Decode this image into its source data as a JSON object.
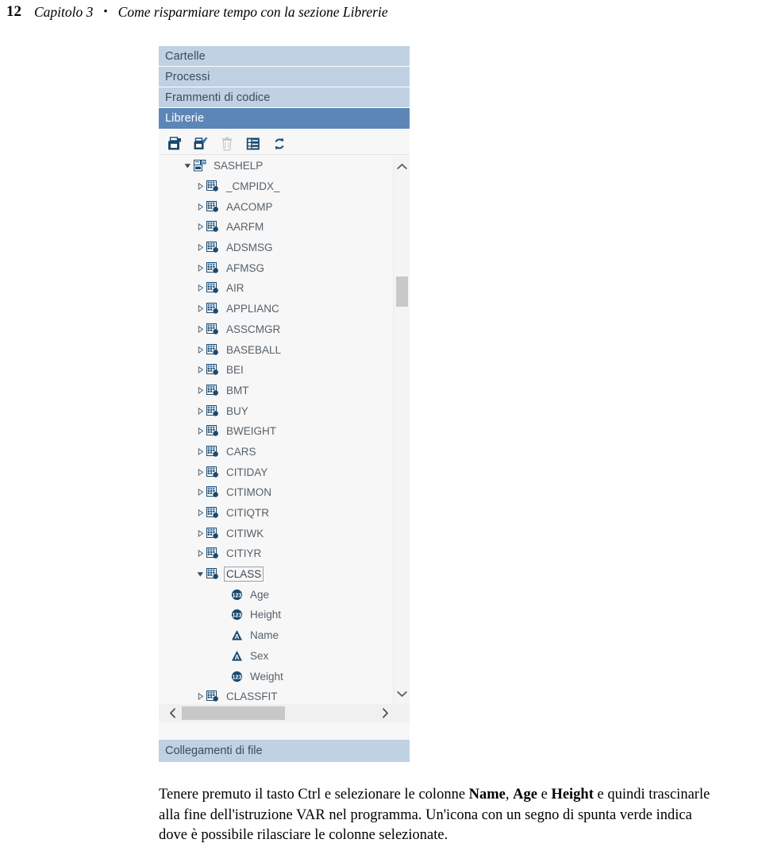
{
  "running_head": {
    "page_number": "12",
    "chapter": "Capitolo 3",
    "separator": "•",
    "title": "Come risparmiare tempo con la sezione Librerie"
  },
  "panel": {
    "tabs": [
      {
        "label": "Cartelle",
        "active": false
      },
      {
        "label": "Processi",
        "active": false
      },
      {
        "label": "Frammenti di codice",
        "active": false
      },
      {
        "label": "Librerie",
        "active": true
      }
    ],
    "toolbar": [
      {
        "name": "new-library-icon",
        "title": "Nuova libreria",
        "enabled": true
      },
      {
        "name": "edit-library-icon",
        "title": "Modifica libreria",
        "enabled": true
      },
      {
        "name": "delete-icon",
        "title": "Elimina",
        "enabled": false
      },
      {
        "name": "properties-icon",
        "title": "Proprieta",
        "enabled": true
      },
      {
        "name": "refresh-icon",
        "title": "Aggiorna",
        "enabled": true
      }
    ],
    "tree": [
      {
        "label": "SASHELP",
        "level": 0,
        "icon": "library-icon",
        "state": "expanded",
        "selected": false
      },
      {
        "label": "_CMPIDX_",
        "level": 1,
        "icon": "dataset-icon",
        "state": "collapsed",
        "selected": false
      },
      {
        "label": "AACOMP",
        "level": 1,
        "icon": "dataset-icon",
        "state": "collapsed",
        "selected": false
      },
      {
        "label": "AARFM",
        "level": 1,
        "icon": "dataset-icon",
        "state": "collapsed",
        "selected": false
      },
      {
        "label": "ADSMSG",
        "level": 1,
        "icon": "dataset-icon",
        "state": "collapsed",
        "selected": false
      },
      {
        "label": "AFMSG",
        "level": 1,
        "icon": "dataset-icon",
        "state": "collapsed",
        "selected": false
      },
      {
        "label": "AIR",
        "level": 1,
        "icon": "dataset-icon",
        "state": "collapsed",
        "selected": false
      },
      {
        "label": "APPLIANC",
        "level": 1,
        "icon": "dataset-icon",
        "state": "collapsed",
        "selected": false
      },
      {
        "label": "ASSCMGR",
        "level": 1,
        "icon": "dataset-icon",
        "state": "collapsed",
        "selected": false
      },
      {
        "label": "BASEBALL",
        "level": 1,
        "icon": "dataset-icon",
        "state": "collapsed",
        "selected": false
      },
      {
        "label": "BEI",
        "level": 1,
        "icon": "dataset-icon",
        "state": "collapsed",
        "selected": false
      },
      {
        "label": "BMT",
        "level": 1,
        "icon": "dataset-icon",
        "state": "collapsed",
        "selected": false
      },
      {
        "label": "BUY",
        "level": 1,
        "icon": "dataset-icon",
        "state": "collapsed",
        "selected": false
      },
      {
        "label": "BWEIGHT",
        "level": 1,
        "icon": "dataset-icon",
        "state": "collapsed",
        "selected": false
      },
      {
        "label": "CARS",
        "level": 1,
        "icon": "dataset-icon",
        "state": "collapsed",
        "selected": false
      },
      {
        "label": "CITIDAY",
        "level": 1,
        "icon": "dataset-icon",
        "state": "collapsed",
        "selected": false
      },
      {
        "label": "CITIMON",
        "level": 1,
        "icon": "dataset-icon",
        "state": "collapsed",
        "selected": false
      },
      {
        "label": "CITIQTR",
        "level": 1,
        "icon": "dataset-icon",
        "state": "collapsed",
        "selected": false
      },
      {
        "label": "CITIWK",
        "level": 1,
        "icon": "dataset-icon",
        "state": "collapsed",
        "selected": false
      },
      {
        "label": "CITIYR",
        "level": 1,
        "icon": "dataset-icon",
        "state": "collapsed",
        "selected": false
      },
      {
        "label": "CLASS",
        "level": 1,
        "icon": "dataset-icon",
        "state": "expanded",
        "selected": true
      },
      {
        "label": "Age",
        "level": 2,
        "icon": "numeric-column-icon",
        "state": "none",
        "selected": false
      },
      {
        "label": "Height",
        "level": 2,
        "icon": "numeric-column-icon",
        "state": "none",
        "selected": false
      },
      {
        "label": "Name",
        "level": 2,
        "icon": "character-column-icon",
        "state": "none",
        "selected": false
      },
      {
        "label": "Sex",
        "level": 2,
        "icon": "character-column-icon",
        "state": "none",
        "selected": false
      },
      {
        "label": "Weight",
        "level": 2,
        "icon": "numeric-column-icon",
        "state": "none",
        "selected": false
      },
      {
        "label": "CLASSFIT",
        "level": 1,
        "icon": "dataset-icon",
        "state": "collapsed",
        "selected": false
      }
    ],
    "footer_tab": {
      "label": "Collegamenti di file"
    }
  },
  "caption": {
    "part1": "Tenere premuto il tasto Ctrl e selezionare le colonne ",
    "bold1": "Name",
    "part2": ", ",
    "bold2": "Age",
    "part3": " e ",
    "bold3": "Height",
    "part4": " e quindi trascinarle alla fine dell'istruzione VAR nel programma. Un'icona con un segno di spunta verde indica dove è possibile rilasciare le colonne selezionate."
  },
  "colors": {
    "tab_inactive_bg": "#bfd1e2",
    "tab_active_bg": "#5d86b8",
    "panel_bg": "#f7f7f7",
    "icon_blue": "#1b4a6e",
    "icon_accent": "#2f74b5",
    "text": "#56616b"
  }
}
